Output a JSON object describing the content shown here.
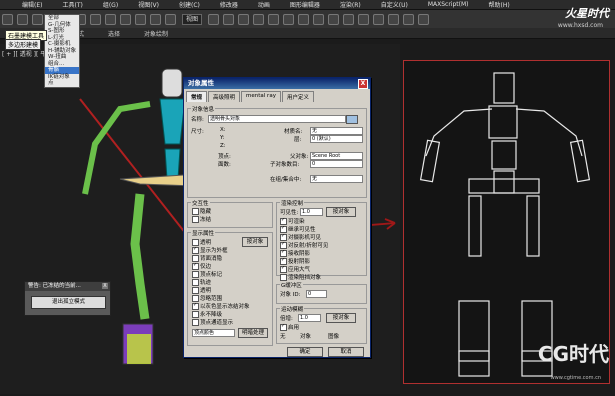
{
  "menubar": [
    "编辑(E)",
    "工具(T)",
    "组(G)",
    "视图(V)",
    "创建(C)",
    "修改器",
    "动画",
    "图形编辑器",
    "渲染(R)",
    "自定义(U)",
    "MAXScript(M)",
    "帮助(H)"
  ],
  "toolbar": {
    "filter": "全部",
    "view_select": "视图"
  },
  "ribbon": [
    "自由形式",
    "选择",
    "对象绘制"
  ],
  "filter_dropdown": [
    "全部",
    "G-几何体",
    "S-图形",
    "L-灯光",
    "C-摄影机",
    "H-辅助对象",
    "W-扭曲",
    "组合...",
    "骨骼",
    "IK链对象",
    "点"
  ],
  "tooltips": {
    "select_tip": "石墨建模工具",
    "poly_tip": "多边形建模"
  },
  "viewport": {
    "label": "[ + ][ 透视 ][ 平滑 + 高光 ]"
  },
  "dialog": {
    "title": "对象属性",
    "close": "X",
    "tabs": [
      "常规",
      "高级照明",
      "mental ray",
      "用户定义"
    ],
    "info_group": "对象信息",
    "name_label": "名称:",
    "name_value": "透明骨头对象",
    "dims_label": "尺寸:",
    "x": "X:",
    "y": "Y:",
    "z": "Z:",
    "material_label": "材质名:",
    "material_value": "无",
    "layer_label": "层:",
    "layer_value": "0 (默认)",
    "verts": "顶点:",
    "faces": "面数:",
    "parent_label": "父对象:",
    "parent_value": "Scene Root",
    "children_label": "子对象数目:",
    "children_value": "0",
    "group_label": "在组/集合中:",
    "group_value": "无",
    "interactivity_group": "交互性",
    "hide": "隐藏",
    "freeze": "冻结",
    "display_group": "显示属性",
    "transparent": "透明",
    "display_as_box": "显示为外框",
    "backface_cull": "背面消隐",
    "edges_only": "仅边",
    "vertex_ticks": "顶点标记",
    "trajectory": "轨迹",
    "see_through": "透明",
    "ignore_extents": "忽略范围",
    "gray_frozen": "以灰色显示冻结对象",
    "never_degrade": "永不降级",
    "vertex_channel": "顶点通道显示",
    "vertex_color": "顶点颜色",
    "shaded": "明暗处理",
    "by_object": "按对象",
    "render_group": "渲染控制",
    "visibility": "可见性:",
    "visibility_value": "1.0",
    "renderable": "可渲染",
    "inherit_vis": "继承可见性",
    "vis_camera": "对摄影机可见",
    "vis_reflect": "对反射/折射可见",
    "receive_shadows": "接收阴影",
    "cast_shadows": "投射阴影",
    "apply_atmos": "应用大气",
    "render_occluded": "渲染阻挡对象",
    "gbuffer_group": "G缓冲区",
    "object_id": "对象 ID:",
    "object_id_value": "0",
    "motion_blur_group": "运动模糊",
    "multiplier": "倍增:",
    "multiplier_value": "1.0",
    "enabled": "启用",
    "none": "无",
    "object": "对象",
    "image": "图像",
    "ok": "确定",
    "cancel": "取消"
  },
  "popup": {
    "title": "警告: 已冻结的当前...",
    "close": "X",
    "button": "退出孤立模式"
  },
  "branding": {
    "top": "火星时代",
    "top_url": "www.hxsd.com",
    "bottom": "CG时代",
    "bottom_url": "www.cgtime.com.cn"
  }
}
